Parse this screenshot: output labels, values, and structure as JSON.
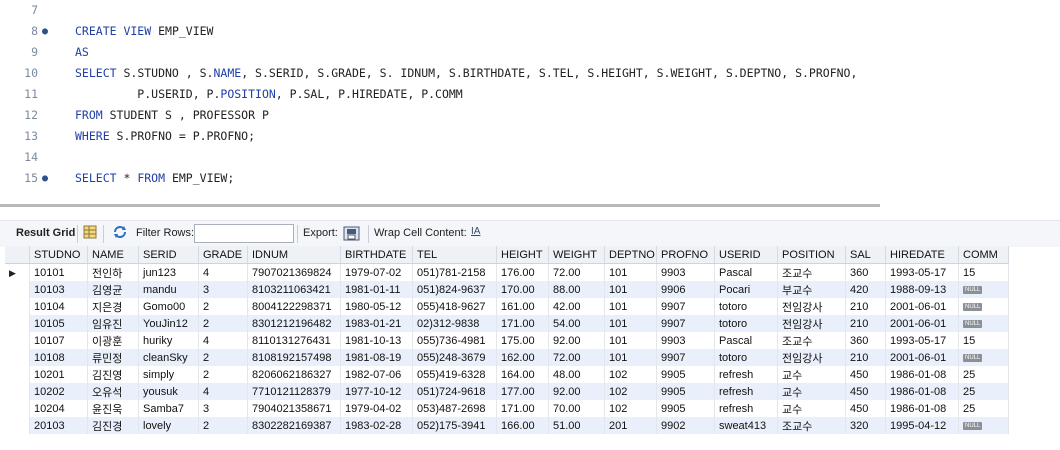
{
  "editor": {
    "lines": [
      {
        "num": "7",
        "marker": "",
        "html": ""
      },
      {
        "num": "8",
        "marker": "●",
        "html": "<span class='kw'>CREATE VIEW</span> EMP_VIEW"
      },
      {
        "num": "9",
        "marker": "",
        "html": "<span class='kw'>AS</span>"
      },
      {
        "num": "10",
        "marker": "",
        "html": "<span class='kw'>SELECT</span> S.STUDNO , S.<span class='kw'>NAME</span>, S.SERID, S.GRADE, S. IDNUM, S.BIRTHDATE, S.TEL, S.HEIGHT, S.WEIGHT, S.DEPTNO, S.PROFNO,"
      },
      {
        "num": "11",
        "marker": "",
        "html": "         P.USERID, P.<span class='kw'>POSITION</span>, P.SAL, P.HIREDATE, P.COMM"
      },
      {
        "num": "12",
        "marker": "",
        "html": "<span class='kw'>FROM</span> STUDENT S , PROFESSOR P"
      },
      {
        "num": "13",
        "marker": "",
        "html": "<span class='kw'>WHERE</span> S.PROFNO = P.PROFNO;"
      },
      {
        "num": "14",
        "marker": "",
        "html": ""
      },
      {
        "num": "15",
        "marker": "●",
        "html": "<span class='kw'>SELECT</span> * <span class='kw'>FROM</span> EMP_VIEW;"
      }
    ]
  },
  "toolbar": {
    "result_grid": "Result Grid",
    "filter_rows": "Filter Rows:",
    "export": "Export:",
    "wrap": "Wrap Cell Content:",
    "wrap_icon": "IA"
  },
  "grid": {
    "columns": [
      "STUDNO",
      "NAME",
      "SERID",
      "GRADE",
      "IDNUM",
      "BIRTHDATE",
      "TEL",
      "HEIGHT",
      "WEIGHT",
      "DEPTNO",
      "PROFNO",
      "USERID",
      "POSITION",
      "SAL",
      "HIREDATE",
      "COMM"
    ],
    "widths": [
      58,
      51,
      60,
      49,
      93,
      72,
      84,
      52,
      56,
      52,
      58,
      63,
      68,
      40,
      73,
      50
    ],
    "null_label": "NULL",
    "rows": [
      [
        "10101",
        "전인하",
        "jun123",
        "4",
        "7907021369824",
        "1979-07-02",
        "051)781-2158",
        "176.00",
        "72.00",
        "101",
        "9903",
        "Pascal",
        "조교수",
        "360",
        "1993-05-17",
        "15"
      ],
      [
        "10103",
        "김영균",
        "mandu",
        "3",
        "8103211063421",
        "1981-01-11",
        "051)824-9637",
        "170.00",
        "88.00",
        "101",
        "9906",
        "Pocari",
        "부교수",
        "420",
        "1988-09-13",
        null
      ],
      [
        "10104",
        "지은경",
        "Gomo00",
        "2",
        "8004122298371",
        "1980-05-12",
        "055)418-9627",
        "161.00",
        "42.00",
        "101",
        "9907",
        "totoro",
        "전임강사",
        "210",
        "2001-06-01",
        null
      ],
      [
        "10105",
        "임유진",
        "YouJin12",
        "2",
        "8301212196482",
        "1983-01-21",
        "02)312-9838",
        "171.00",
        "54.00",
        "101",
        "9907",
        "totoro",
        "전임강사",
        "210",
        "2001-06-01",
        null
      ],
      [
        "10107",
        "이광훈",
        "huriky",
        "4",
        "8110131276431",
        "1981-10-13",
        "055)736-4981",
        "175.00",
        "92.00",
        "101",
        "9903",
        "Pascal",
        "조교수",
        "360",
        "1993-05-17",
        "15"
      ],
      [
        "10108",
        "류민정",
        "cleanSky",
        "2",
        "8108192157498",
        "1981-08-19",
        "055)248-3679",
        "162.00",
        "72.00",
        "101",
        "9907",
        "totoro",
        "전임강사",
        "210",
        "2001-06-01",
        null
      ],
      [
        "10201",
        "김진영",
        "simply",
        "2",
        "8206062186327",
        "1982-07-06",
        "055)419-6328",
        "164.00",
        "48.00",
        "102",
        "9905",
        "refresh",
        "교수",
        "450",
        "1986-01-08",
        "25"
      ],
      [
        "10202",
        "오유석",
        "yousuk",
        "4",
        "7710121128379",
        "1977-10-12",
        "051)724-9618",
        "177.00",
        "92.00",
        "102",
        "9905",
        "refresh",
        "교수",
        "450",
        "1986-01-08",
        "25"
      ],
      [
        "10204",
        "윤진욱",
        "Samba7",
        "3",
        "7904021358671",
        "1979-04-02",
        "053)487-2698",
        "171.00",
        "70.00",
        "102",
        "9905",
        "refresh",
        "교수",
        "450",
        "1986-01-08",
        "25"
      ],
      [
        "20103",
        "김진경",
        "lovely",
        "2",
        "8302282169387",
        "1983-02-28",
        "052)175-3941",
        "166.00",
        "51.00",
        "201",
        "9902",
        "sweat413",
        "조교수",
        "320",
        "1995-04-12",
        null
      ]
    ]
  }
}
